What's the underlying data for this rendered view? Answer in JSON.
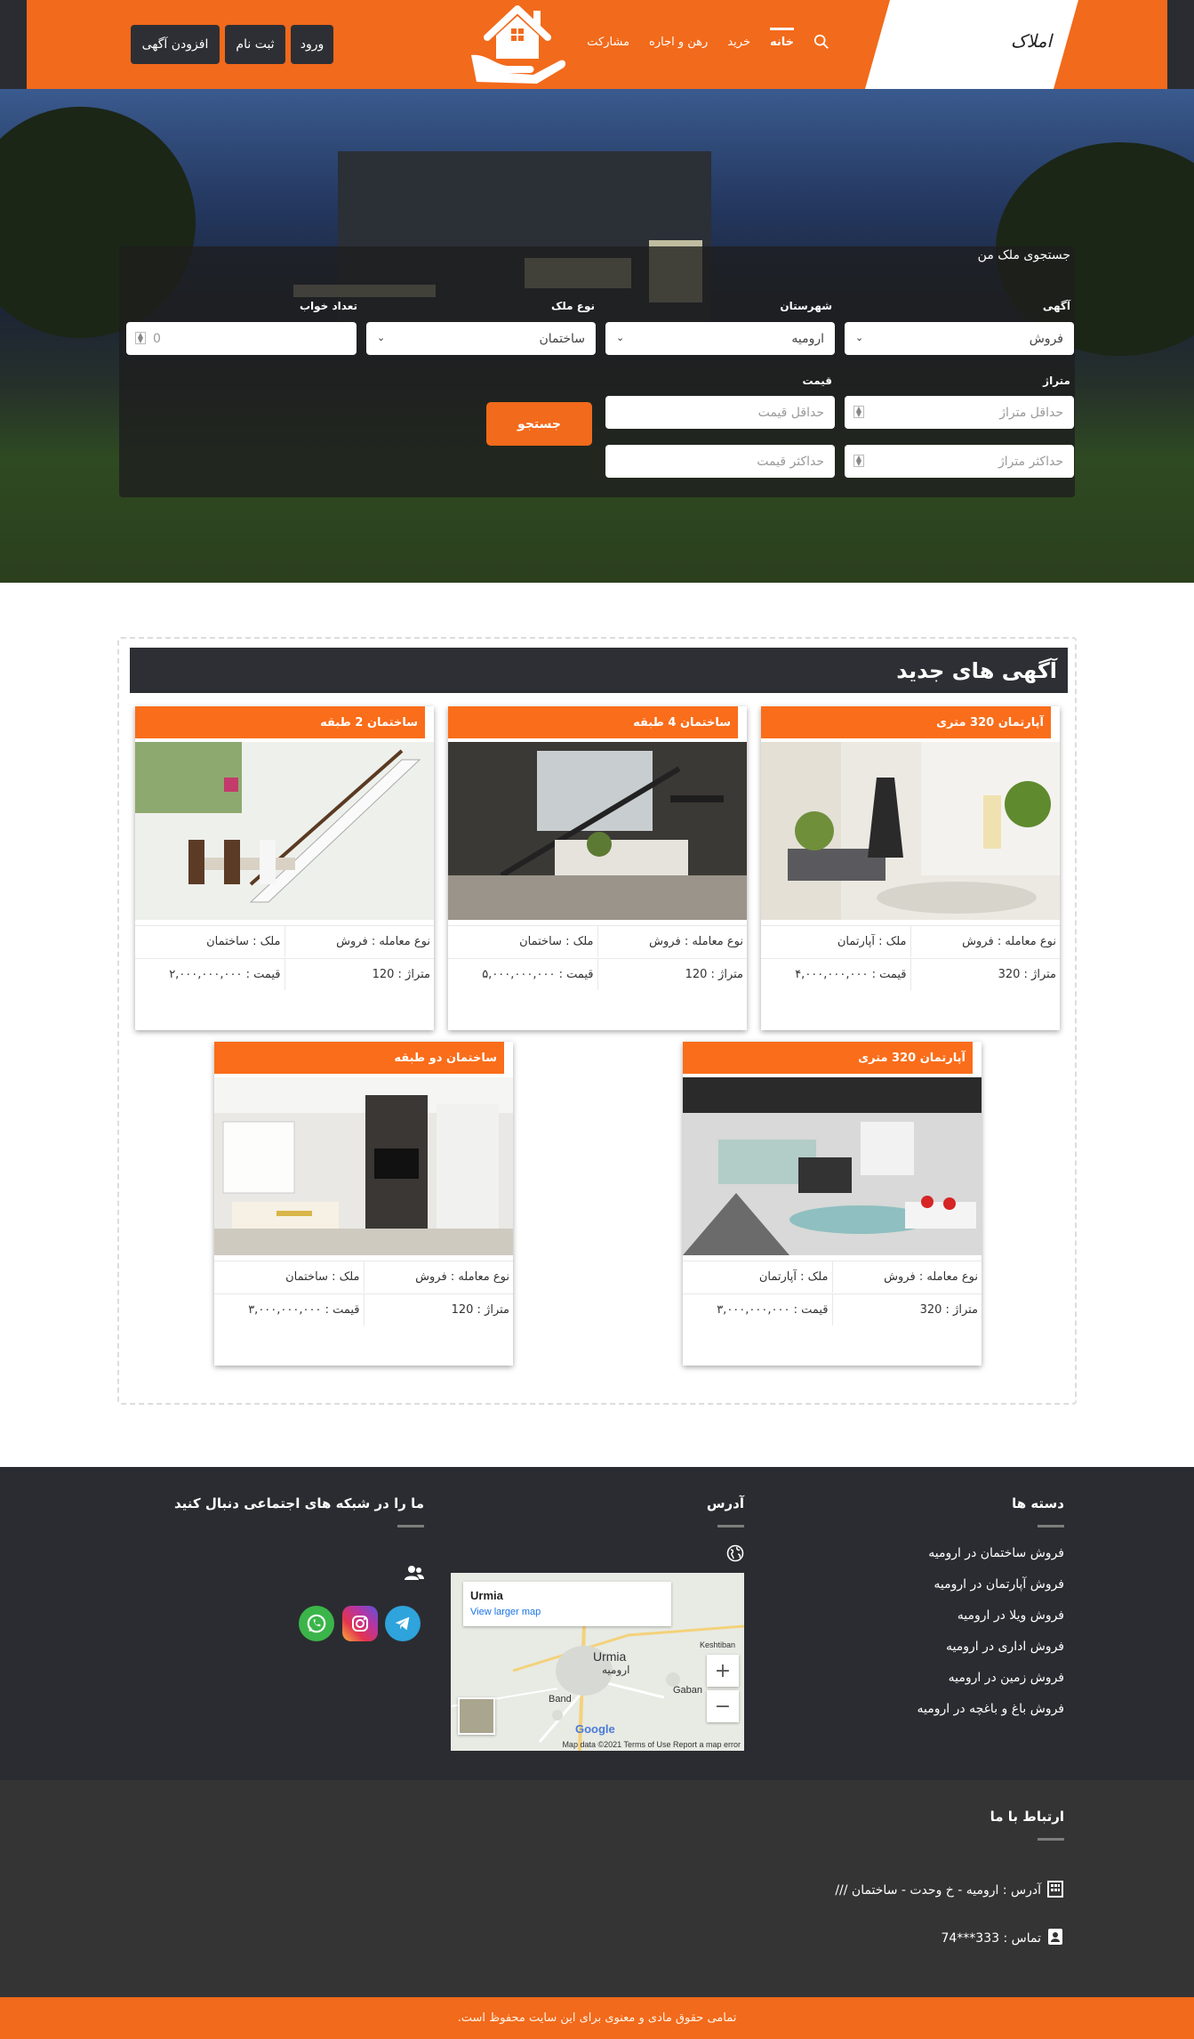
{
  "header": {
    "brand": "املاک",
    "nav": [
      "خانه",
      "خرید",
      "رهن و اجاره",
      "مشارکت"
    ],
    "login": "ورود",
    "register": "ثبت نام",
    "add_listing": "افزودن آگهی",
    "colors": {
      "primary": "#f26a1b",
      "dark": "#2a2c31"
    }
  },
  "search": {
    "title": "جستجوی ملک من",
    "ad_label": "آگهی",
    "ad_value": "فروش",
    "city_label": "شهرستان",
    "city_value": "ارومیه",
    "type_label": "نوع ملک",
    "type_value": "ساختمان",
    "bedrooms_label": "تعداد خواب",
    "bedrooms_value": "0",
    "area_label": "متراژ",
    "area_min_placeholder": "حداقل متراژ",
    "area_max_placeholder": "حداکثر متراژ",
    "price_label": "قیمت",
    "price_min_placeholder": "حداقل قیمت",
    "price_max_placeholder": "حداکثر قیمت",
    "submit": "جستجو"
  },
  "listings": {
    "heading": "آگهی های جدید",
    "items": [
      {
        "title": "آپارتمان 320 متری",
        "deal": "نوع معامله : فروش",
        "kind": "ملک : آپارتمان",
        "area": "متراژ : 320",
        "price": "قیمت : ۴,۰۰۰,۰۰۰,۰۰۰"
      },
      {
        "title": "ساختمان 4 طبقه",
        "deal": "نوع معامله : فروش",
        "kind": "ملک : ساختمان",
        "area": "متراژ : 120",
        "price": "قیمت : ۵,۰۰۰,۰۰۰,۰۰۰"
      },
      {
        "title": "ساختمان 2 طبقه",
        "deal": "نوع معامله : فروش",
        "kind": "ملک : ساختمان",
        "area": "متراژ : 120",
        "price": "قیمت : ۲,۰۰۰,۰۰۰,۰۰۰"
      },
      {
        "title": "آپارتمان 320 متری",
        "deal": "نوع معامله : فروش",
        "kind": "ملک : آپارتمان",
        "area": "متراژ : 320",
        "price": "قیمت : ۳,۰۰۰,۰۰۰,۰۰۰"
      },
      {
        "title": "ساختمان دو طبقه",
        "deal": "نوع معامله : فروش",
        "kind": "ملک : ساختمان",
        "area": "متراژ : 120",
        "price": "قیمت : ۳,۰۰۰,۰۰۰,۰۰۰"
      }
    ]
  },
  "footer": {
    "categories_title": "دسته ها",
    "categories": [
      "فروش ساختمان در ارومیه",
      "فروش آپارتمان در ارومیه",
      "فروش ویلا در ارومیه",
      "فروش اداری در ارومیه",
      "فروش زمین در ارومیه",
      "فروش باغ و باغچه در ارومیه"
    ],
    "address_title": "آدرس",
    "social_title": "ما را در شبکه های اجتماعی دنبال کنید",
    "map": {
      "city": "Urmia",
      "link": "View larger map",
      "label_en": "Urmia",
      "label_fa": "ارومیه",
      "band": "Band",
      "gaban": "Gaban",
      "kesh": "Keshtiban",
      "google": "Google",
      "credit": "Map data ©2021    Terms of Use    Report a map error"
    },
    "contact_title": "ارتباط با ما",
    "address": "آدرس : ارومیه - خ وحدت - ساختمان ///",
    "phone": "تماس : 333***74",
    "copyright": "تمامی حقوق مادی و معنوی برای این سایت محفوظ است."
  }
}
